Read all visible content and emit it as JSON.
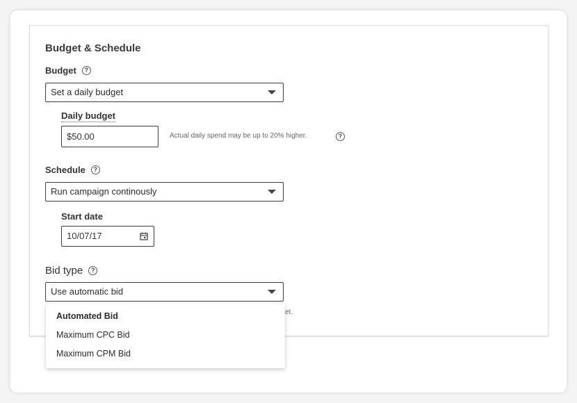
{
  "section_title": "Budget & Schedule",
  "budget": {
    "label": "Budget",
    "select_value": "Set a daily budget",
    "daily_budget_label": "Daily budget",
    "daily_budget_value": "$50.00",
    "hint": "Actual daily spend may be up to 20% higher."
  },
  "schedule": {
    "label": "Schedule",
    "select_value": "Run campaign continously",
    "start_date_label": "Start date",
    "start_date_value": "10/07/17"
  },
  "bid_type": {
    "label": "Bid type",
    "select_value": "Use automatic bid",
    "hidden_hint_tail": "et.",
    "options": [
      {
        "label": "Automated Bid",
        "selected": true
      },
      {
        "label": "Maximum CPC Bid",
        "selected": false
      },
      {
        "label": "Maximum CPM Bid",
        "selected": false
      }
    ]
  },
  "icons": {
    "help": "question-circle-icon",
    "caret": "chevron-down-icon",
    "calendar": "calendar-icon"
  }
}
